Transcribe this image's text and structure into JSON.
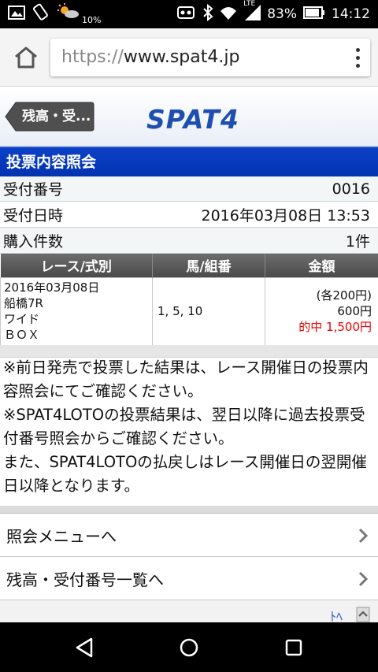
{
  "status_bar": {
    "battery_small": "10%",
    "network": "LTE",
    "battery": "83%",
    "time": "14:12",
    "icons": [
      "image-icon",
      "rotate-icon",
      "weather-icon",
      "vibrate-icon",
      "bluetooth-icon",
      "wifi-icon",
      "signal-icon",
      "battery-icon"
    ]
  },
  "browser": {
    "url_scheme": "https://",
    "url_host": "www.spat4.jp"
  },
  "header": {
    "back_label": "残高・受...",
    "logo": "SPAT4"
  },
  "page_title": "投票内容照会",
  "info_rows": [
    {
      "label": "受付番号",
      "value": "0016"
    },
    {
      "label": "受付日時",
      "value": "2016年03月08日 13:53"
    },
    {
      "label": "購入件数",
      "value": "1件"
    }
  ],
  "table": {
    "headers": [
      "レース/式別",
      "馬/組番",
      "金額"
    ],
    "row": {
      "date": "2016年03月08日",
      "race": "船橋7R",
      "bet_type": "ワイド",
      "box": "ＢＯＸ",
      "horses": "1, 5, 10",
      "unit": "(各200円)",
      "total": "600円",
      "hit": "的中 1,500円"
    }
  },
  "notes": [
    "※前日発売で投票した結果は、レース開催日の投票内容照会にてご確認ください。",
    "※SPAT4LOTOの投票結果は、翌日以降に過去投票受付番号照会からご確認ください。",
    "また、SPAT4LOTOの払戻しはレース開催日の翌開催日以降となります。"
  ],
  "menu": [
    {
      "label": "照会メニューへ"
    },
    {
      "label": "残高・受付番号一覧へ"
    }
  ],
  "colors": {
    "title_bar": "#0d41c8",
    "logo": "#1e4fb0",
    "hit": "#e00000"
  }
}
